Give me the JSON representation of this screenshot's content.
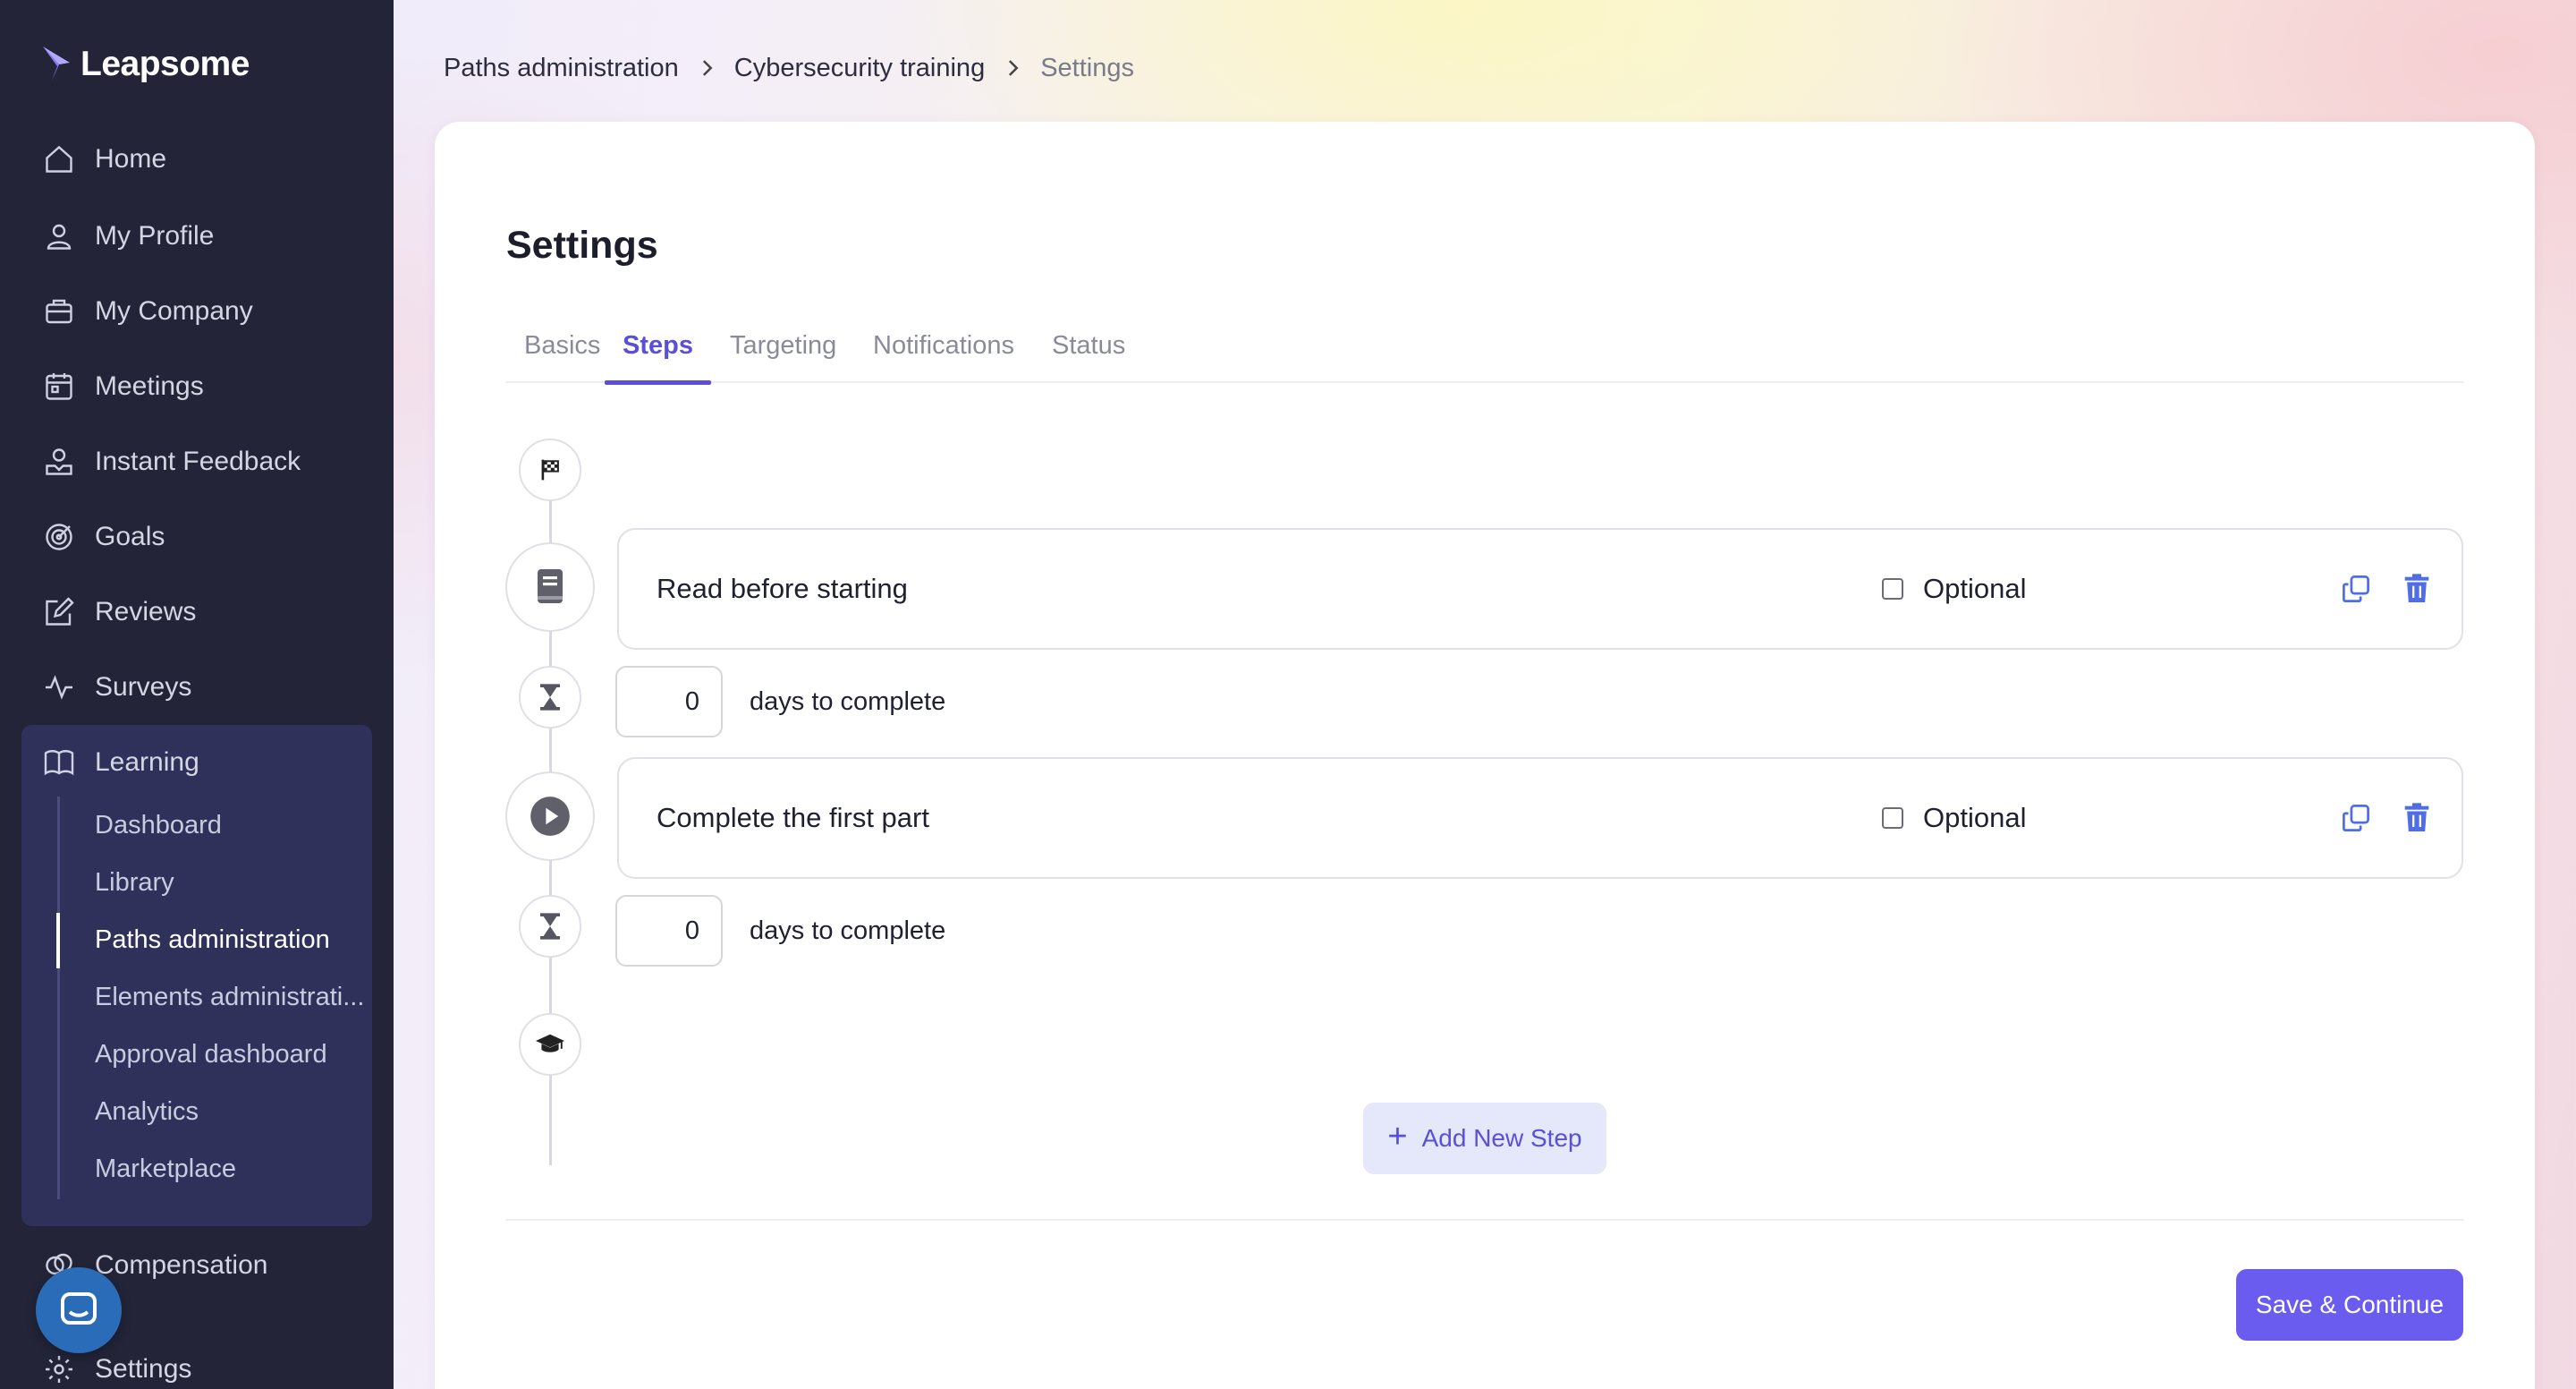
{
  "app": {
    "name": "Leapsome"
  },
  "sidebar": {
    "items": [
      {
        "label": "Home",
        "icon": "home-icon"
      },
      {
        "label": "My Profile",
        "icon": "user-icon"
      },
      {
        "label": "My Company",
        "icon": "briefcase-icon"
      },
      {
        "label": "Meetings",
        "icon": "calendar-icon"
      },
      {
        "label": "Instant Feedback",
        "icon": "feedback-icon"
      },
      {
        "label": "Goals",
        "icon": "target-icon"
      },
      {
        "label": "Reviews",
        "icon": "edit-icon"
      },
      {
        "label": "Surveys",
        "icon": "pulse-icon"
      },
      {
        "label": "Learning",
        "icon": "book-open-icon"
      },
      {
        "label": "Compensation",
        "icon": "coins-icon"
      },
      {
        "label": "Settings",
        "icon": "gear-icon"
      }
    ],
    "learning_sub": [
      {
        "label": "Dashboard"
      },
      {
        "label": "Library"
      },
      {
        "label": "Paths administration",
        "active": true
      },
      {
        "label": "Elements administrati..."
      },
      {
        "label": "Approval dashboard"
      },
      {
        "label": "Analytics"
      },
      {
        "label": "Marketplace"
      }
    ]
  },
  "breadcrumb": {
    "items": [
      "Paths administration",
      "Cybersecurity training"
    ],
    "current": "Settings"
  },
  "page": {
    "title": "Settings",
    "tabs": [
      {
        "label": "Basics"
      },
      {
        "label": "Steps",
        "active": true
      },
      {
        "label": "Targeting"
      },
      {
        "label": "Notifications"
      },
      {
        "label": "Status"
      }
    ]
  },
  "steps": [
    {
      "title": "Read before starting",
      "icon": "book-icon",
      "optional_label": "Optional",
      "optional": false,
      "days": "0",
      "days_label": "days to complete"
    },
    {
      "title": "Complete the first part",
      "icon": "play-icon",
      "optional_label": "Optional",
      "optional": false,
      "days": "0",
      "days_label": "days to complete"
    }
  ],
  "actions": {
    "add_step": "Add New Step",
    "save": "Save & Continue"
  },
  "colors": {
    "sidebar_bg": "#232438",
    "accent": "#5a4fd6",
    "primary_button": "#6b5cf0",
    "add_button_bg": "#e5e8fb",
    "learning_group_bg": "#30315a"
  }
}
